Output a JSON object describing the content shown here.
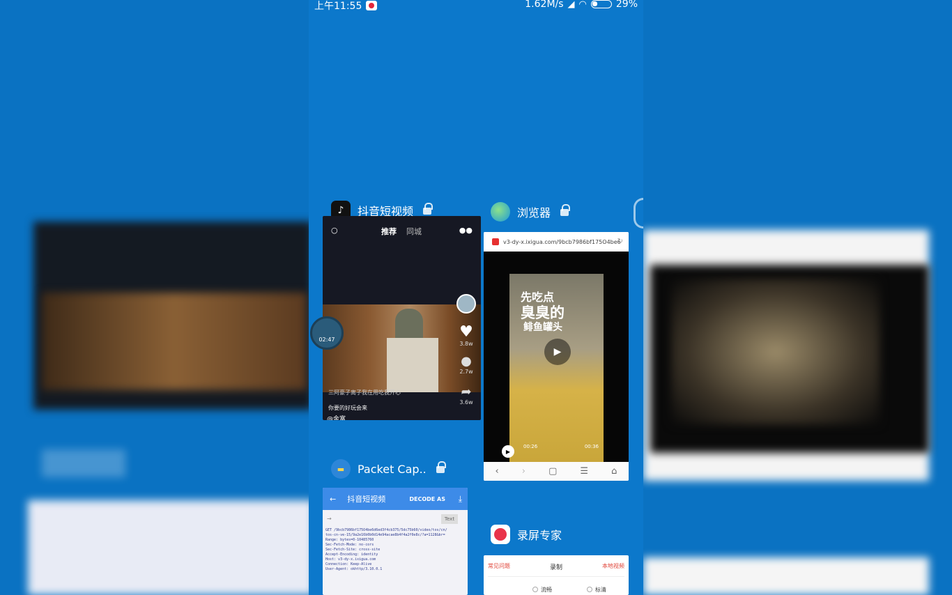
{
  "status_bar": {
    "time": "上午11:55",
    "network_speed": "1.62M/s",
    "battery": "29%"
  },
  "cards": {
    "douyin": {
      "app_name": "抖音短视频",
      "tabs": {
        "recommend": "推荐",
        "city": "同城"
      },
      "counts": {
        "likes": "3.8w",
        "comments": "2.7w",
        "shares": "3.6w"
      },
      "caption": "三阿豪子离子我在用吃我开心",
      "music": "你要的好玩会来",
      "user": "@金富"
    },
    "floating_ball": {
      "time": "02:47"
    },
    "browser": {
      "app_name": "浏览器",
      "url": "v3-dy-x.ixigua.com/9bcb7986bf175O4be6",
      "video_title_1": "先吃点",
      "video_title_2": "臭臭的",
      "video_title_3": "鲱鱼罐头",
      "time_current": "00:26",
      "time_total": "00:36"
    },
    "packet_capture": {
      "app_name": "Packet Cap..",
      "title": "抖音短视频",
      "decode_as": "DECODE AS",
      "text_button": "Text",
      "request_lines": [
        "GET /9bcb7986bf175O4be6d6ed3f4cb375/5dc75b60/video/tos/cn/",
        "tos-cn-ve-15/9a2e16b0b0d14e94acae8b4f4a2f0e8c/?a=1128&br=",
        "Range: bytes=0-10485760",
        "Sec-Fetch-Mode: no-cors",
        "Sec-Fetch-Site: cross-site",
        "Accept-Encoding: identity",
        "Host: v3-dy-x.ixigua.com",
        "Connection: Keep-Alive",
        "User-Agent: okhttp/3.10.0.1"
      ]
    },
    "screen_recorder": {
      "app_name": "录屏专家",
      "faq": "常见问题",
      "record": "录制",
      "local_videos": "本地视频",
      "option_smooth": "流畅",
      "option_sd": "标清"
    }
  },
  "colors": {
    "background": "#0a72c2",
    "accent_blue": "#3d8be8",
    "accent_red": "#e0463a"
  }
}
